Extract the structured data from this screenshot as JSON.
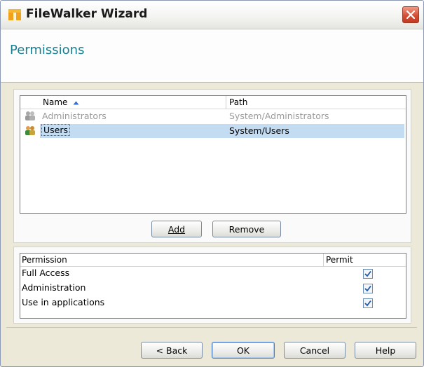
{
  "window": {
    "title": "FileWalker Wizard"
  },
  "header": {
    "title": "Permissions"
  },
  "members": {
    "columns": {
      "name": "Name",
      "path": "Path"
    },
    "rows": [
      {
        "name": "Administrators",
        "path": "System/Administrators",
        "dimmed": true
      },
      {
        "name": "Users",
        "path": "System/Users",
        "selected": true
      }
    ],
    "add_label": "Add",
    "remove_label": "Remove"
  },
  "permissions": {
    "columns": {
      "permission": "Permission",
      "permit": "Permit"
    },
    "rows": [
      {
        "label": "Full Access",
        "checked": true
      },
      {
        "label": "Administration",
        "checked": true
      },
      {
        "label": "Use in applications",
        "checked": true
      }
    ]
  },
  "footer": {
    "back_label": "< Back",
    "ok_label": "OK",
    "cancel_label": "Cancel",
    "help_label": "Help"
  },
  "colors": {
    "title_accent": "#1a7f8e",
    "selection": "#c3dcf2"
  },
  "icons": {
    "app": "folder-walker-icon",
    "close": "close-icon",
    "group": "user-group-icon",
    "sort": "sort-ascending-icon",
    "check": "checkmark-icon"
  }
}
